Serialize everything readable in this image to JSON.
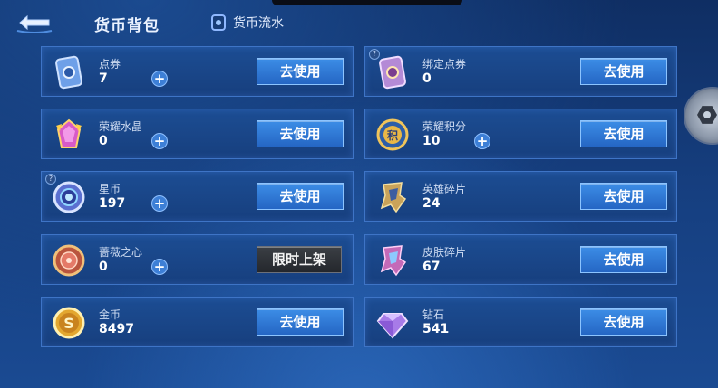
{
  "header": {
    "title": "货币背包",
    "flow_label": "货币流水"
  },
  "items": [
    {
      "id": "dianquan",
      "name": "点券",
      "value": "7",
      "button": "去使用",
      "has_plus": true,
      "has_info": false,
      "icon": "point-coupon-icon"
    },
    {
      "id": "bangding",
      "name": "绑定点券",
      "value": "0",
      "button": "去使用",
      "has_plus": false,
      "has_info": true,
      "icon": "bound-coupon-icon"
    },
    {
      "id": "shuijing",
      "name": "荣耀水晶",
      "value": "0",
      "button": "去使用",
      "has_plus": true,
      "has_info": false,
      "icon": "glory-crystal-icon"
    },
    {
      "id": "jifen",
      "name": "荣耀积分",
      "value": "10",
      "button": "去使用",
      "has_plus": true,
      "has_info": false,
      "icon": "glory-points-icon"
    },
    {
      "id": "xingbi",
      "name": "星币",
      "value": "197",
      "button": "去使用",
      "has_plus": true,
      "has_info": true,
      "icon": "star-coin-icon"
    },
    {
      "id": "yingxiong",
      "name": "英雄碎片",
      "value": "24",
      "button": "去使用",
      "has_plus": false,
      "has_info": false,
      "icon": "hero-shard-icon"
    },
    {
      "id": "qiangwei",
      "name": "蔷薇之心",
      "value": "0",
      "button": "限时上架",
      "has_plus": true,
      "has_info": false,
      "icon": "rose-heart-icon"
    },
    {
      "id": "pifu",
      "name": "皮肤碎片",
      "value": "67",
      "button": "去使用",
      "has_plus": false,
      "has_info": false,
      "icon": "skin-shard-icon"
    },
    {
      "id": "jinbi",
      "name": "金币",
      "value": "8497",
      "button": "去使用",
      "has_plus": false,
      "has_info": false,
      "icon": "gold-coin-icon"
    },
    {
      "id": "zuanshi",
      "name": "钻石",
      "value": "541",
      "button": "去使用",
      "has_plus": false,
      "has_info": false,
      "icon": "diamond-icon"
    }
  ]
}
